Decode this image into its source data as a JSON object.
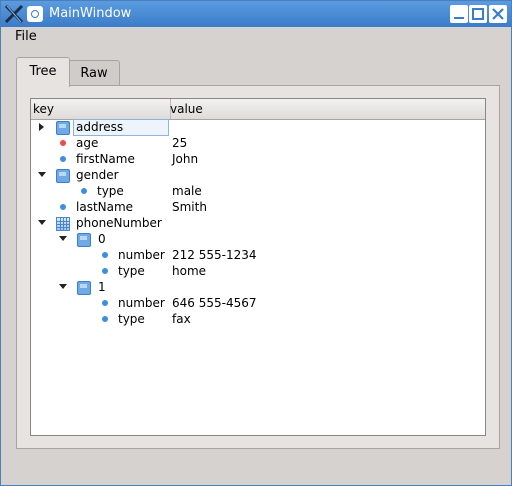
{
  "window": {
    "title": "MainWindow"
  },
  "menubar": {
    "file": "File"
  },
  "tabs": [
    {
      "label": "Tree"
    },
    {
      "label": "Raw"
    }
  ],
  "tree": {
    "headers": {
      "key": "key",
      "value": "value"
    },
    "rows": [
      {
        "key": "address",
        "value": "",
        "icon": "object-cube-icon"
      },
      {
        "key": "age",
        "value": "25",
        "icon": "number-dot-icon"
      },
      {
        "key": "firstName",
        "value": "John",
        "icon": "string-dot-icon"
      },
      {
        "key": "gender",
        "value": "",
        "icon": "object-cube-icon"
      },
      {
        "key": "type",
        "value": "male",
        "icon": "string-dot-icon"
      },
      {
        "key": "lastName",
        "value": "Smith",
        "icon": "string-dot-icon"
      },
      {
        "key": "phoneNumber",
        "value": "",
        "icon": "array-grid-icon"
      },
      {
        "key": "0",
        "value": "",
        "icon": "object-cube-icon"
      },
      {
        "key": "number",
        "value": "212 555-1234",
        "icon": "string-dot-icon"
      },
      {
        "key": "type",
        "value": "home",
        "icon": "string-dot-icon"
      },
      {
        "key": "1",
        "value": "",
        "icon": "object-cube-icon"
      },
      {
        "key": "number",
        "value": "646 555-4567",
        "icon": "string-dot-icon"
      },
      {
        "key": "type",
        "value": "fax",
        "icon": "string-dot-icon"
      }
    ]
  }
}
